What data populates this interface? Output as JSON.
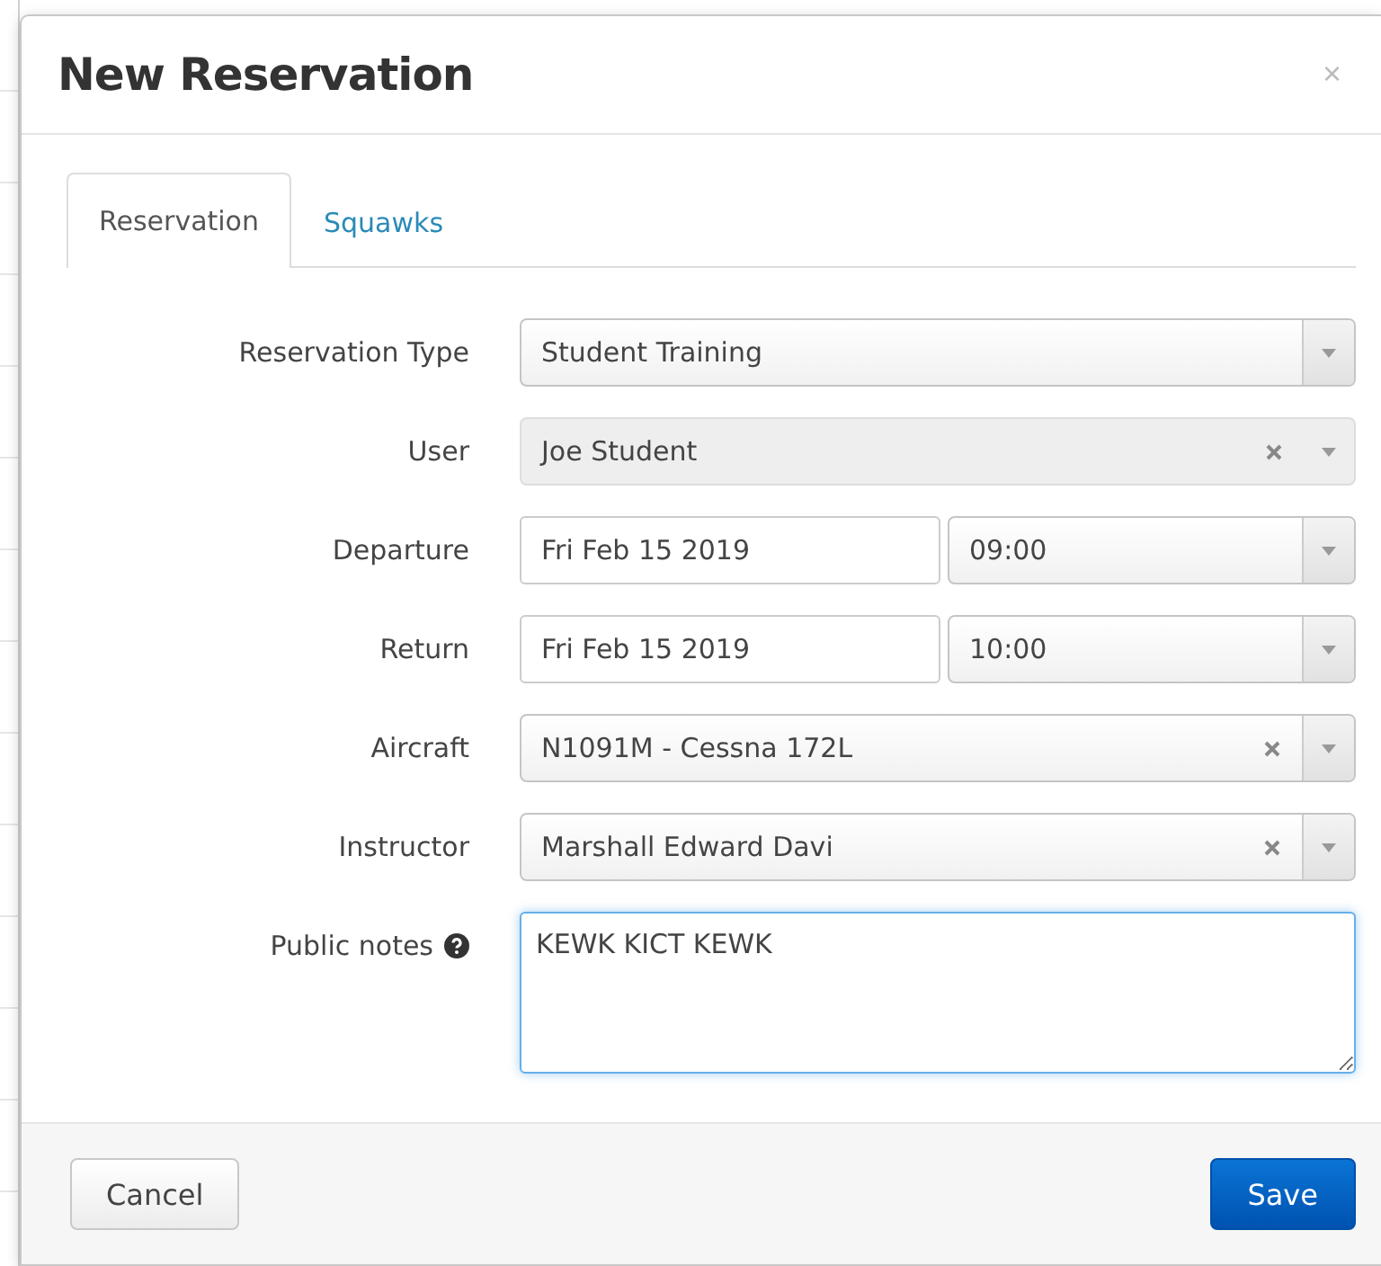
{
  "dialog": {
    "title": "New Reservation",
    "close": "×"
  },
  "tabs": [
    {
      "label": "Reservation",
      "selected": true
    },
    {
      "label": "Squawks",
      "selected": false
    }
  ],
  "fields": [
    {
      "kind": "select",
      "label": "Reservation Type",
      "value": "Student Training",
      "clearable": false,
      "disabled": false
    },
    {
      "kind": "select",
      "label": "User",
      "value": "Joe Student",
      "clearable": true,
      "disabled": true
    },
    {
      "kind": "datetime",
      "label": "Departure",
      "date": "Fri Feb 15 2019",
      "time": "09:00"
    },
    {
      "kind": "datetime",
      "label": "Return",
      "date": "Fri Feb 15 2019",
      "time": "10:00"
    },
    {
      "kind": "select",
      "label": "Aircraft",
      "value": "N1091M - Cessna 172L",
      "clearable": true,
      "disabled": false
    },
    {
      "kind": "select",
      "label": "Instructor",
      "value": "Marshall Edward Davi",
      "clearable": true,
      "disabled": false
    },
    {
      "kind": "textarea",
      "label": "Public notes",
      "help": true,
      "value": "KEWK KICT KEWK",
      "focused": true
    }
  ],
  "buttons": {
    "cancel": "Cancel",
    "save": "Save"
  }
}
